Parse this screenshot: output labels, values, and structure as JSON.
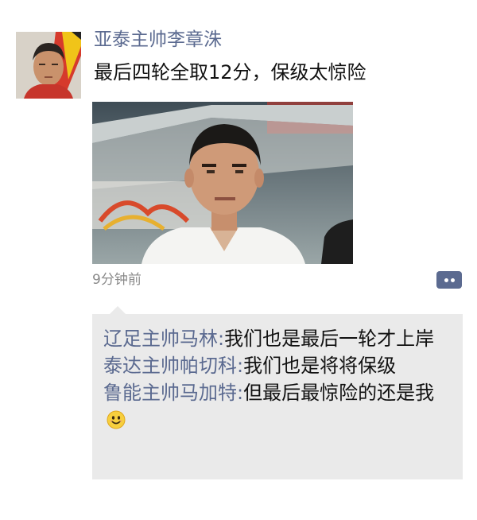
{
  "post": {
    "author": "亚泰主帅李章洙",
    "text": "最后四轮全取12分，保级太惊险",
    "timestamp": "9分钟前"
  },
  "comments": [
    {
      "name": "辽足主帅马林",
      "separator": ":",
      "text": "我们也是最后一轮才上岸"
    },
    {
      "name": "泰达主帅帕切科",
      "separator": ":",
      "text": "我们也是将将保级"
    },
    {
      "name": "鲁能主帅马加特",
      "separator": ":",
      "text": "但最后最惊险的还是我"
    }
  ],
  "icons": {
    "comment_button": "comment-icon",
    "emoji": "smiley-emoji-icon"
  },
  "colors": {
    "author_name": "#5b6a90",
    "text": "#111111",
    "timestamp": "#8a8a8a",
    "comments_background": "#eaeaea",
    "comment_button": "#5b6a90"
  }
}
